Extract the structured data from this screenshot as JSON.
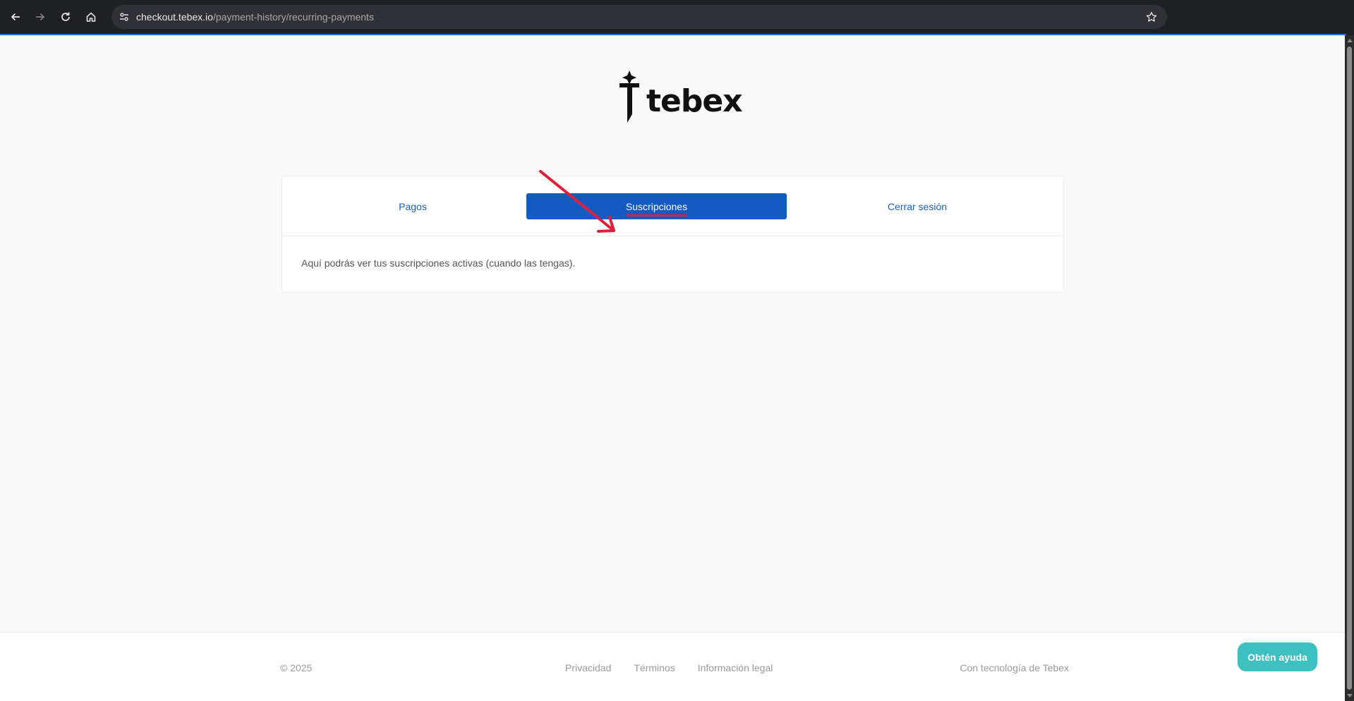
{
  "browser": {
    "url_host": "checkout.tebex.io",
    "url_path": "/payment-history/recurring-payments",
    "icons": {
      "back": "back-arrow-icon",
      "forward": "forward-arrow-icon",
      "reload": "reload-icon",
      "home": "home-icon",
      "site_info": "site-info-icon",
      "bookmark": "star-icon"
    }
  },
  "logo": {
    "text": "tebex"
  },
  "tabs": [
    {
      "label": "Pagos",
      "active": false
    },
    {
      "label": "Suscripciones",
      "active": true
    },
    {
      "label": "Cerrar sesión",
      "active": false
    }
  ],
  "content": {
    "message": "Aquí podrás ver tus suscripciones activas (cuando las tengas)."
  },
  "footer": {
    "copyright": "© 2025",
    "links": [
      "Privacidad",
      "Términos",
      "Información legal"
    ],
    "powered_by": "Con tecnología de Tebex"
  },
  "help_button": {
    "label": "Obtén ayuda"
  },
  "colors": {
    "accent": "#135bc0",
    "link": "#1a5fc0",
    "annotation": "#e02039",
    "help": "#3cc1c0"
  }
}
